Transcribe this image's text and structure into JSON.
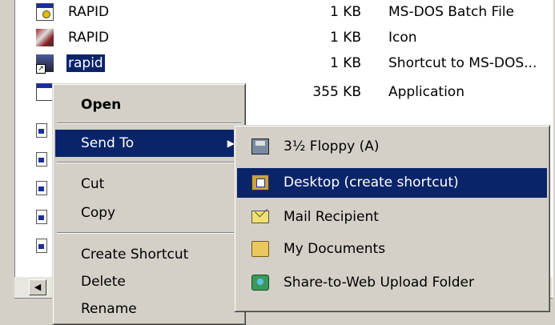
{
  "files": [
    {
      "name": "RAPID",
      "size": "1 KB",
      "type": "MS-DOS Batch File",
      "icon": "batch-file-icon",
      "selected": false
    },
    {
      "name": "RAPID",
      "size": "1 KB",
      "type": "Icon",
      "icon": "icon-file-icon",
      "selected": false
    },
    {
      "name": "rapid",
      "size": "1 KB",
      "type": "Shortcut to MS-DOS...",
      "icon": "shortcut-icon",
      "selected": true
    },
    {
      "name": "",
      "size": "355 KB",
      "type": "Application",
      "icon": "application-icon",
      "selected": false
    }
  ],
  "context_menu": {
    "open": "Open",
    "send_to": "Send To",
    "cut": "Cut",
    "copy": "Copy",
    "create_shortcut": "Create Shortcut",
    "delete": "Delete",
    "rename": "Rename"
  },
  "send_to_menu": {
    "floppy": "3½ Floppy (A)",
    "desktop": "Desktop (create shortcut)",
    "mail": "Mail Recipient",
    "my_documents": "My Documents",
    "share_web": "Share-to-Web Upload Folder"
  },
  "colors": {
    "highlight": "#0a246a",
    "face": "#d4d0c8"
  }
}
